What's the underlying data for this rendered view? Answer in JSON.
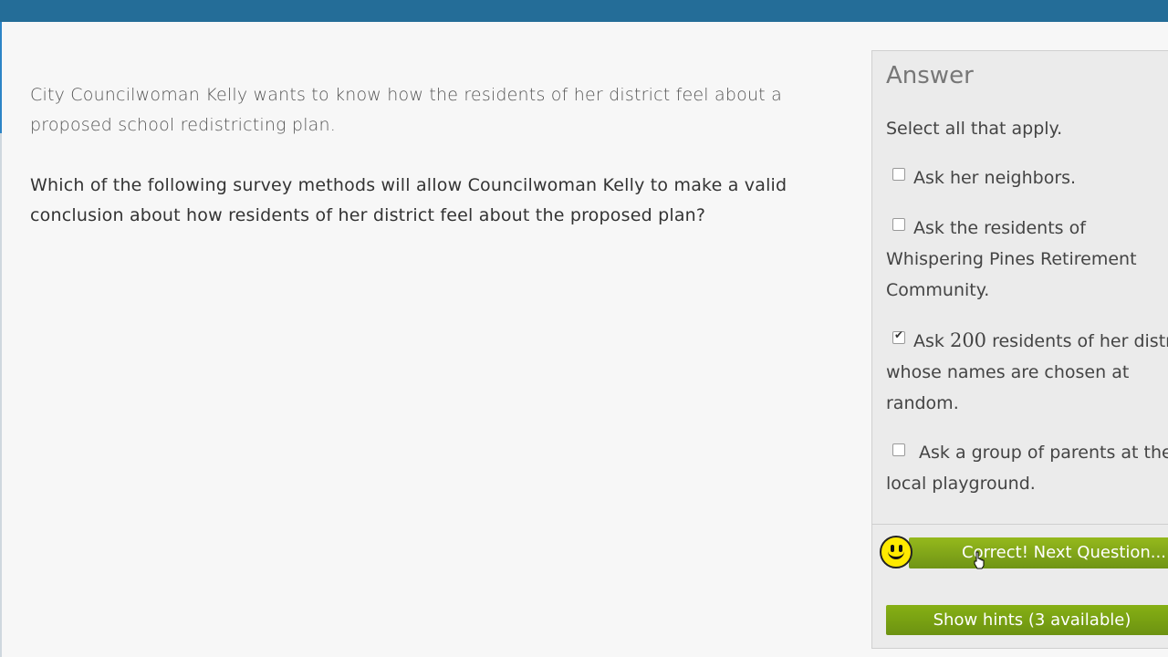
{
  "problem": {
    "intro": "City Councilwoman Kelly wants to know how the residents of her district feel about a proposed school redistricting plan.",
    "question": "Which of the following survey methods will allow Councilwoman Kelly to make a valid conclusion about how residents of her district feel about the proposed plan?"
  },
  "answer": {
    "title": "Answer",
    "instruction": "Select all that apply.",
    "options": [
      {
        "label": "Ask her neighbors.",
        "checked": false
      },
      {
        "label": "Ask the residents of Whispering Pines Retirement Community.",
        "checked": false
      },
      {
        "label_prefix": "Ask",
        "number": "200",
        "label_suffix": "residents of her district whose names are chosen at random.",
        "checked": true
      },
      {
        "label": "Ask a group of parents at the local playground.",
        "checked": false
      }
    ],
    "correct_button": "Correct! Next Question...",
    "hints_button": "Show hints (3 available)"
  },
  "icons": {
    "feedback": "smiley-icon",
    "pointer": "hand-cursor-icon"
  },
  "colors": {
    "topbar": "#246d98",
    "button_green": "#7aa315",
    "smiley_yellow": "#ffea00"
  }
}
